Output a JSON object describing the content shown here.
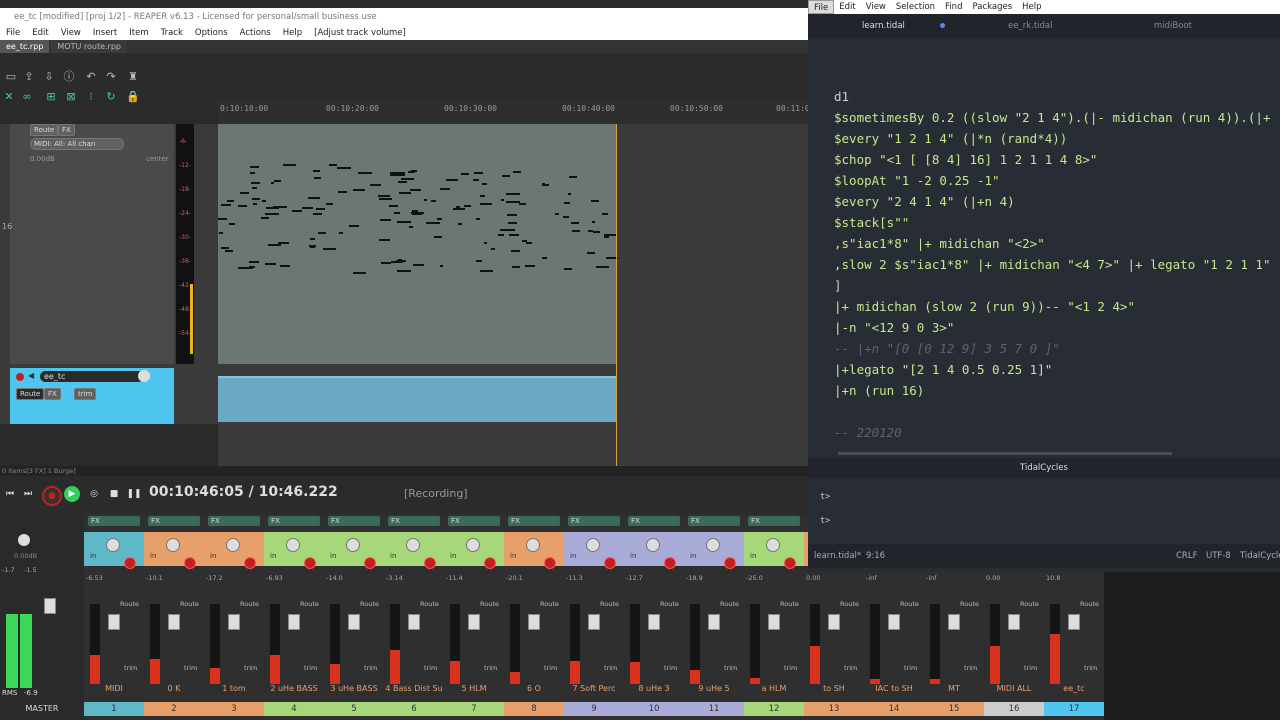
{
  "reaper": {
    "window_title": "ee_tc [modified] [proj 1/2] - REAPER v6.13 - Licensed for personal/small business use",
    "menu": [
      "File",
      "Edit",
      "View",
      "Insert",
      "Item",
      "Track",
      "Options",
      "Actions",
      "Help",
      "[Adjust track volume]"
    ],
    "project_tabs": [
      "ee_tc.rpp",
      "MOTU route.rpp"
    ],
    "ruler_ticks": [
      "0:10:10:00",
      "00:10:20:00",
      "00:10:30:00",
      "00:10:40:00",
      "00:10:50:00",
      "00:11:00"
    ],
    "track1": {
      "number": "16",
      "midi_input": "MIDI: All: All chan",
      "route": "Route",
      "fx": "FX",
      "volume": "0.00dB",
      "pan": "center"
    },
    "track2": {
      "name": "ee_tc",
      "route": "Route",
      "fx": "FX",
      "trim": "trim",
      "number": "17"
    },
    "meter_ticks": [
      "-6-",
      "-12-",
      "-18-",
      "-24-",
      "-30-",
      "-36-",
      "-42-",
      "-48-",
      "-54-"
    ],
    "status_line": "0 items[3 FX] 1 Burge]",
    "transport": {
      "timecode": "00:10:46:05 / 10:46.222",
      "state": "[Recording]"
    },
    "mixer": {
      "master_label": "MASTER",
      "master_rms": "RMS",
      "master_rms_value": "-6.9",
      "master_levels": [
        "-1.7",
        "-1.5"
      ],
      "master_volume": "0.00dB",
      "strips": [
        {
          "label": "MIDI",
          "num": "1",
          "color": "#5fb8c8",
          "value": "-6.53"
        },
        {
          "label": "0 K",
          "num": "2",
          "color": "#e8a06a",
          "value": "-10.1"
        },
        {
          "label": "1 tom",
          "num": "3",
          "color": "#e8a06a",
          "value": "-17.2"
        },
        {
          "label": "2 uHe BASS",
          "num": "4",
          "color": "#a6d87a",
          "value": "-6.93"
        },
        {
          "label": "3 uHe BASS",
          "num": "5",
          "color": "#a6d87a",
          "value": "-14.0"
        },
        {
          "label": "4 Bass Dist Su",
          "num": "6",
          "color": "#a6d87a",
          "value": "-3.14"
        },
        {
          "label": "5 HLM",
          "num": "7",
          "color": "#a6d87a",
          "value": "-11.4"
        },
        {
          "label": "6 O",
          "num": "8",
          "color": "#e8a06a",
          "value": "-20.1"
        },
        {
          "label": "7 Soft Perc",
          "num": "9",
          "color": "#a9acd8",
          "value": "-11.3"
        },
        {
          "label": "8 uHe 3",
          "num": "10",
          "color": "#a9acd8",
          "value": "-12.7"
        },
        {
          "label": "9 uHe 5",
          "num": "11",
          "color": "#a9acd8",
          "value": "-18.9"
        },
        {
          "label": "a HLM",
          "num": "12",
          "color": "#a6d87a",
          "value": "-25.0"
        },
        {
          "label": "to SH",
          "num": "13",
          "color": "#e8a06a",
          "value": "0.00"
        },
        {
          "label": "IAC to SH",
          "num": "14",
          "color": "#e8a06a",
          "value": "-inf"
        },
        {
          "label": "MT",
          "num": "15",
          "color": "#e8a06a",
          "value": "-inf"
        },
        {
          "label": "MIDI ALL",
          "num": "16",
          "color": "#cccccc",
          "value": "0.00"
        },
        {
          "label": "ee_tc",
          "num": "17",
          "color": "#4fc6f0",
          "value": "10.8"
        }
      ],
      "fx_label": "FX",
      "in_label": "in",
      "route_label": "Route",
      "trim_label": "trim"
    }
  },
  "editor": {
    "menu": [
      "File",
      "Edit",
      "View",
      "Selection",
      "Find",
      "Packages",
      "Help"
    ],
    "tabs": [
      "learn.tidal",
      "ee_rk.tidal",
      "midiBoot"
    ],
    "code_lines": [
      {
        "t": "d1",
        "cls": "w"
      },
      {
        "t": "$sometimesBy 0.2 ((slow \"2 1 4\").(|- midichan (run 4)).(|+",
        "cls": "k"
      },
      {
        "t": "$every \"1 2 1 4\" (|*n (rand*4))",
        "cls": "k"
      },
      {
        "t": "$chop \"<1 [ [8 4] 16] 1 2 1 1 4 8>\"",
        "cls": "k"
      },
      {
        "t": "$loopAt \"1 -2 0.25 -1\"",
        "cls": "k"
      },
      {
        "t": "$every \"2 4 1 4\" (|+n 4)",
        "cls": "k"
      },
      {
        "t": "$stack[s\"\"",
        "cls": "k"
      },
      {
        "t": ",s\"iac1*8\" |+ midichan \"<2>\"",
        "cls": "k"
      },
      {
        "t": ",slow 2 $s\"iac1*8\" |+ midichan \"<4 7>\" |+ legato \"1 2 1 1\"",
        "cls": "k"
      },
      {
        "t": "]",
        "cls": "w"
      },
      {
        "t": "|+ midichan (slow 2 (run 9))-- \"<1 2 4>\"",
        "cls": "k"
      },
      {
        "t": "|-n \"<12 9 0 3>\"",
        "cls": "k"
      },
      {
        "t": "-- |+n \"[0 [0 12 9] 3 5 7 0 ]\"",
        "cls": "c"
      },
      {
        "t": "|+legato \"[2 1 4 0.5 0.25 1]\"",
        "cls": "k"
      },
      {
        "t": "|+n (run 16)",
        "cls": "k"
      },
      {
        "t": "",
        "cls": "w"
      },
      {
        "t": "-- 220120",
        "cls": "c"
      }
    ],
    "panel_title": "TidalCycles",
    "prompts": [
      "t>",
      "t>"
    ],
    "status_left": "learn.tidal*",
    "status_pos": "9:16",
    "status_right": [
      "CRLF",
      "UTF-8",
      "TidalCycle"
    ]
  }
}
